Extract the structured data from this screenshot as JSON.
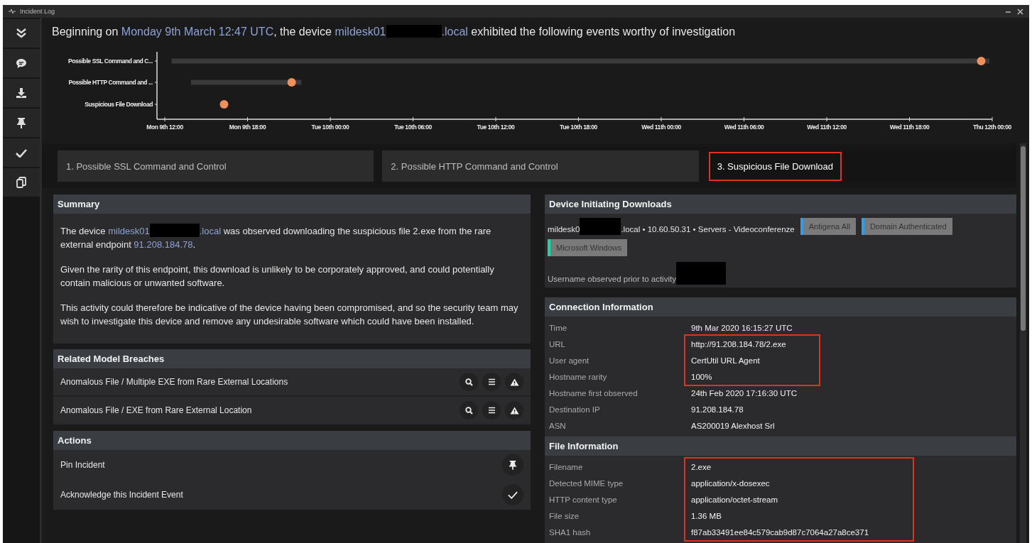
{
  "window": {
    "title": "Incident Log"
  },
  "sidebar": {
    "items": [
      {
        "kind": "collapse"
      },
      {
        "kind": "comment"
      },
      {
        "kind": "download"
      },
      {
        "kind": "pin"
      },
      {
        "kind": "check"
      },
      {
        "kind": "copy"
      }
    ]
  },
  "header": {
    "segments": [
      {
        "kind": "text",
        "text": "Beginning on "
      },
      {
        "kind": "link",
        "text": "Monday 9th March 12:47 UTC"
      },
      {
        "kind": "text",
        "text": ", the device "
      },
      {
        "kind": "link",
        "text": "mildesk01"
      },
      {
        "kind": "redacted"
      },
      {
        "kind": "link",
        "text": ".local"
      },
      {
        "kind": "text",
        "text": " exhibited the following events worthy of investigation"
      }
    ]
  },
  "timeline": {
    "rows": [
      "Possible SSL Command and C...",
      "Possible HTTP Command and ...",
      "Suspicious File Download"
    ],
    "axis_labels": [
      "Mon 9th 12:00",
      "Mon 9th 18:00",
      "Tue 10th 00:00",
      "Tue 10th 06:00",
      "Tue 10th 12:00",
      "Tue 10th 18:00",
      "Wed 11th 00:00",
      "Wed 11th 06:00",
      "Wed 11th 12:00",
      "Wed 11th 18:00",
      "Thu 12th 00:00"
    ]
  },
  "tabs": [
    {
      "label": "1. Possible SSL Command and Control",
      "selected": false
    },
    {
      "label": "2. Possible HTTP Command and Control",
      "selected": false
    },
    {
      "label": "3. Suspicious File Download",
      "selected": true
    }
  ],
  "summary": {
    "title": "Summary",
    "paragraphs": [
      [
        {
          "kind": "text",
          "text": "The device "
        },
        {
          "kind": "link",
          "text": "mildesk01"
        },
        {
          "kind": "redacted"
        },
        {
          "kind": "link",
          "text": ".local"
        },
        {
          "kind": "text",
          "text": " was observed downloading the suspicious file 2.exe from the rare external endpoint "
        },
        {
          "kind": "link",
          "text": "91.208.184.78"
        },
        {
          "kind": "text",
          "text": "."
        }
      ],
      [
        {
          "kind": "text",
          "text": "Given the rarity of this endpoint, this download is unlikely to be corporately approved, and could potentially contain malicious or unwanted software."
        }
      ],
      [
        {
          "kind": "text",
          "text": "This activity could therefore be indicative of the device having been compromised, and so the security team may wish to investigate this device and remove any undesirable software which could have been installed."
        }
      ]
    ]
  },
  "breaches": {
    "title": "Related Model Breaches",
    "items": [
      {
        "name": "Anomalous File / Multiple EXE from Rare External Locations"
      },
      {
        "name": "Anomalous File / EXE from Rare External Location"
      }
    ]
  },
  "actions": {
    "title": "Actions",
    "items": [
      {
        "label": "Pin Incident",
        "kind": "pin"
      },
      {
        "label": "Acknowledge this Incident Event",
        "kind": "check"
      }
    ]
  },
  "device": {
    "title": "Device Initiating Downloads",
    "segments": [
      {
        "kind": "text",
        "text": "mildesk0"
      },
      {
        "kind": "redacted"
      },
      {
        "kind": "text",
        "text": ".local • 10.60.50.31 • Servers - Videoconferenze"
      }
    ],
    "tags": [
      {
        "label": "Antigena All",
        "color": "#2f9ee6"
      },
      {
        "label": "Domain Authenticated",
        "color": "#2f9ee6"
      },
      {
        "label": "Microsoft Windows",
        "color": "#22d3a5"
      }
    ],
    "username": [
      {
        "kind": "text",
        "text": "Username observed prior to activity"
      },
      {
        "kind": "redacted"
      }
    ]
  },
  "connection": {
    "title": "Connection Information",
    "rows": [
      {
        "label": "Time",
        "value": "9th Mar 2020 16:15:27 UTC",
        "highlighted": false
      },
      {
        "label": "URL",
        "value": "http://91.208.184.78/2.exe",
        "highlighted": true
      },
      {
        "label": "User agent",
        "value": "CertUtil URL Agent",
        "highlighted": true
      },
      {
        "label": "Hostname rarity",
        "value": "100%",
        "highlighted": true
      },
      {
        "label": "Hostname first observed",
        "value": "24th Feb 2020 17:16:30 UTC",
        "highlighted": false
      },
      {
        "label": "Destination IP",
        "value": "91.208.184.78",
        "highlighted": false
      },
      {
        "label": "ASN",
        "value": "AS200019 Alexhost Srl",
        "highlighted": false
      }
    ]
  },
  "file": {
    "title": "File Information",
    "rows": [
      {
        "label": "Filename",
        "value": "2.exe",
        "highlighted": true
      },
      {
        "label": "Detected MIME type",
        "value": "application/x-dosexec",
        "highlighted": true
      },
      {
        "label": "HTTP content type",
        "value": "application/octet-stream",
        "highlighted": true
      },
      {
        "label": "File size",
        "value": "1.36 MB",
        "highlighted": true
      },
      {
        "label": "SHA1 hash",
        "value": "f87ab33491ee84c579cab9d87c7064a27a8ce371",
        "highlighted": true
      }
    ]
  }
}
